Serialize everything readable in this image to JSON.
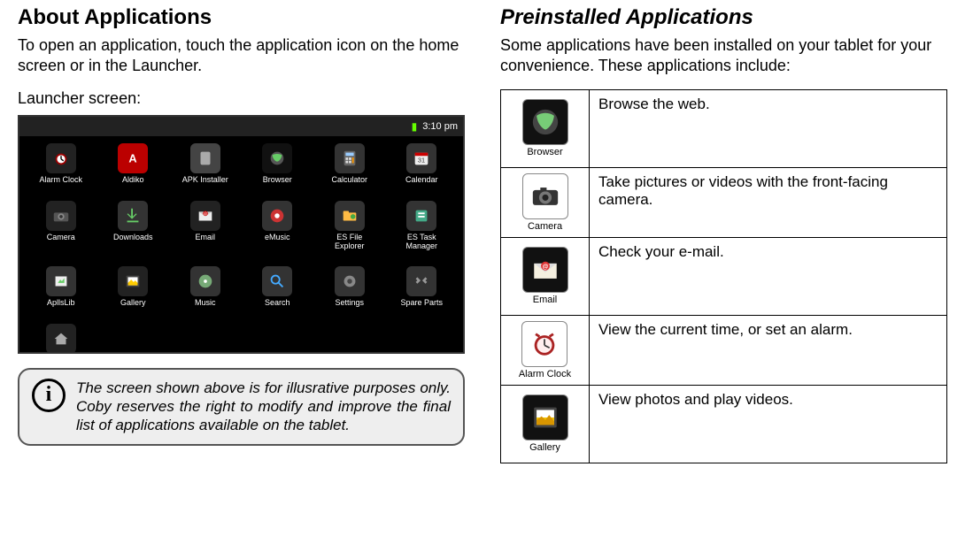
{
  "left": {
    "heading": "About Applications",
    "intro": "To open an application, touch the application icon on the home screen or in the Launcher.",
    "sublabel": "Launcher screen:",
    "status": {
      "time": "3:10 pm"
    },
    "apps": [
      {
        "label": "Alarm Clock"
      },
      {
        "label": "Aldiko"
      },
      {
        "label": "APK Installer"
      },
      {
        "label": "Browser"
      },
      {
        "label": "Calculator"
      },
      {
        "label": "Calendar"
      },
      {
        "label": "Camera"
      },
      {
        "label": "Downloads"
      },
      {
        "label": "Email"
      },
      {
        "label": "eMusic"
      },
      {
        "label": "ES File Explorer"
      },
      {
        "label": "ES Task Manager"
      },
      {
        "label": "ApllsLib"
      },
      {
        "label": "Gallery"
      },
      {
        "label": "Music"
      },
      {
        "label": "Search"
      },
      {
        "label": "Settings"
      },
      {
        "label": "Spare Parts"
      }
    ],
    "info_note": "The screen shown above is for illusrative purposes only. Coby reserves the right to modify and improve the final list of applications available on the tablet."
  },
  "right": {
    "heading": "Preinstalled Applications",
    "intro": "Some applications have been installed on your tablet for your convenience. These applications include:",
    "rows": [
      {
        "name": "Browser",
        "desc": "Browse the web."
      },
      {
        "name": "Camera",
        "desc": "Take pictures or videos with the front-facing camera."
      },
      {
        "name": "Email",
        "desc": "Check your e-mail."
      },
      {
        "name": "Alarm Clock",
        "desc": "View the current time, or set an alarm."
      },
      {
        "name": "Gallery",
        "desc": "View photos and play videos."
      }
    ]
  }
}
